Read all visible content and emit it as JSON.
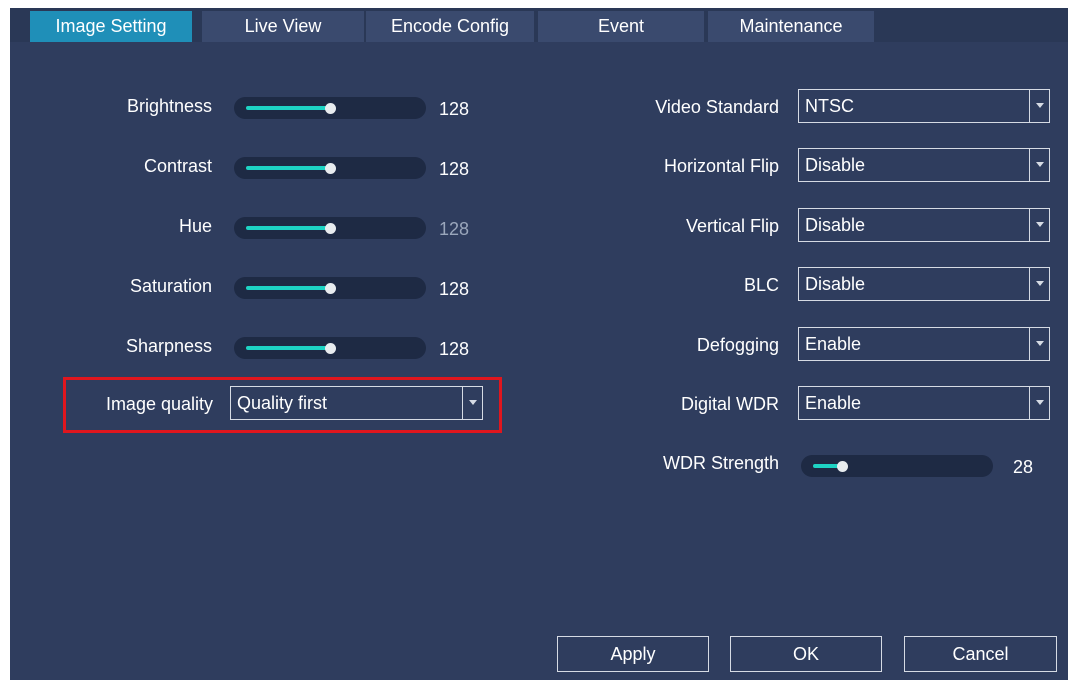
{
  "tabs": [
    {
      "label": "Image Setting",
      "active": true
    },
    {
      "label": "Live View"
    },
    {
      "label": "Encode Config"
    },
    {
      "label": "Event"
    },
    {
      "label": "Maintenance"
    }
  ],
  "left_sliders": [
    {
      "label": "Brightness",
      "value": "128",
      "level": 0.5
    },
    {
      "label": "Contrast",
      "value": "128",
      "level": 0.5
    },
    {
      "label": "Hue",
      "value": "128",
      "level": 0.5
    },
    {
      "label": "Saturation",
      "value": "128",
      "level": 0.5
    },
    {
      "label": "Sharpness",
      "value": "128",
      "level": 0.5
    }
  ],
  "image_quality": {
    "label": "Image quality",
    "value": "Quality first"
  },
  "right_selects": [
    {
      "label": "Video Standard",
      "value": "NTSC"
    },
    {
      "label": "Horizontal Flip",
      "value": "Disable"
    },
    {
      "label": "Vertical Flip",
      "value": "Disable"
    },
    {
      "label": "BLC",
      "value": "Disable"
    },
    {
      "label": "Defogging",
      "value": "Enable"
    },
    {
      "label": "Digital WDR",
      "value": "Enable"
    }
  ],
  "wdr_strength": {
    "label": "WDR Strength",
    "value": "28",
    "level": 0.17
  },
  "buttons": {
    "apply": "Apply",
    "ok": "OK",
    "cancel": "Cancel"
  },
  "colors": {
    "background": "#2f3d5e",
    "active_tab": "#1f8fb8",
    "slider_fill": "#1ed3c4",
    "highlight": "#e0161e"
  }
}
